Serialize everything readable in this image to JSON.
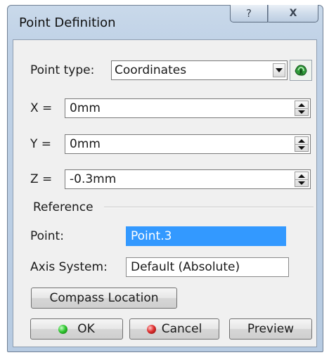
{
  "window": {
    "title": "Point Definition",
    "help_glyph": "?",
    "close_glyph": "X"
  },
  "point_type": {
    "label": "Point type:",
    "value": "Coordinates"
  },
  "coords": {
    "x_label": "X =",
    "x_value": "0mm",
    "y_label": "Y =",
    "y_value": "0mm",
    "z_label": "Z =",
    "z_value": "-0.3mm"
  },
  "reference": {
    "group_label": "Reference",
    "point_label": "Point:",
    "point_value": "Point.3",
    "axis_label": "Axis System:",
    "axis_value": "Default (Absolute)"
  },
  "buttons": {
    "compass": "Compass Location",
    "ok": "OK",
    "cancel": "Cancel",
    "preview": "Preview"
  },
  "colors": {
    "selection": "#3399ff",
    "ok_icon": "#32c832",
    "cancel_icon": "#e03030"
  },
  "icons": [
    "help-icon",
    "close-icon",
    "dropdown-arrow-icon",
    "point-type-tool-icon",
    "spin-up-icon",
    "spin-down-icon",
    "ok-icon",
    "cancel-icon"
  ]
}
